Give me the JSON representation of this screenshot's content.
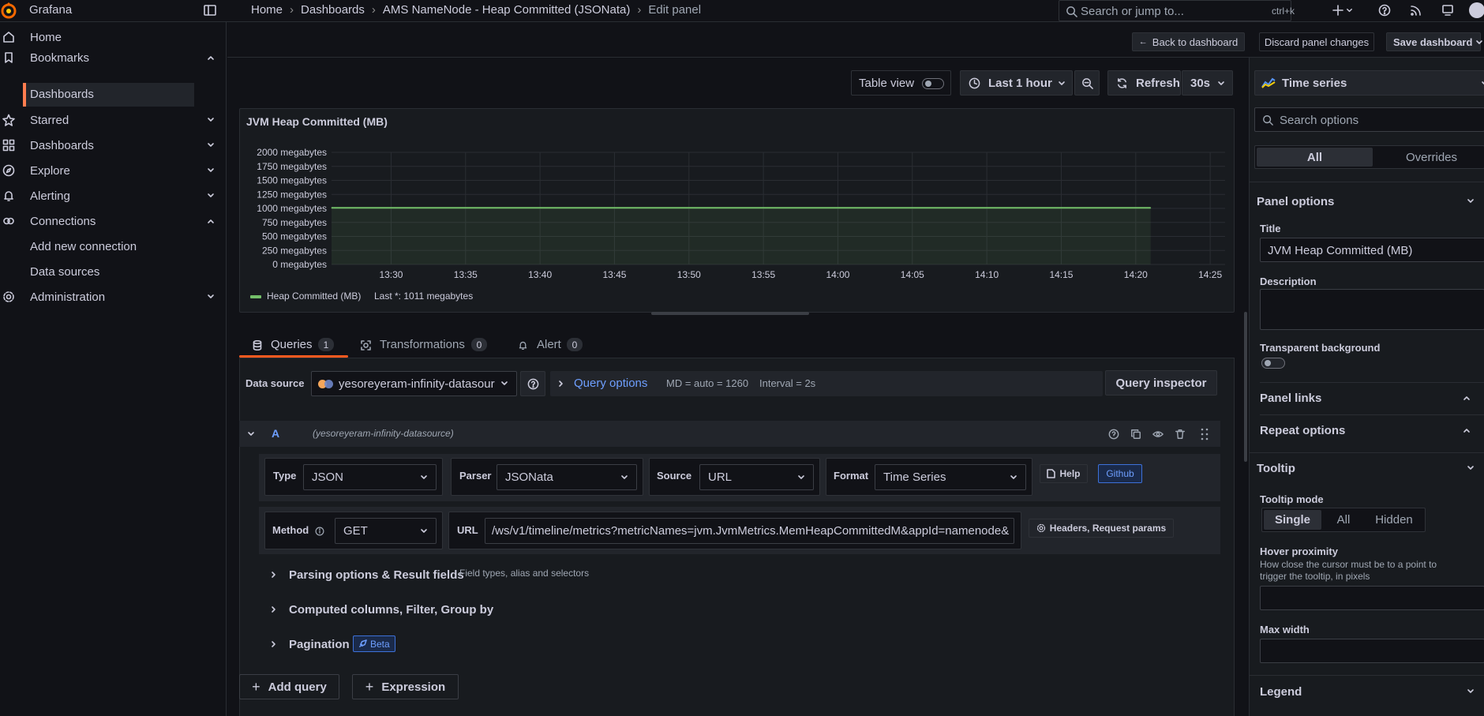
{
  "app": {
    "name": "Grafana"
  },
  "breadcrumb": [
    "Home",
    "Dashboards",
    "AMS NameNode - Heap Committed (JSONata)",
    "Edit panel"
  ],
  "search": {
    "placeholder": "Search or jump to...",
    "shortcut": "ctrl+k"
  },
  "nav": {
    "home": "Home",
    "bookmarks": "Bookmarks",
    "bookmarks_dashboards": "Dashboards",
    "starred": "Starred",
    "dashboards": "Dashboards",
    "explore": "Explore",
    "alerting": "Alerting",
    "connections": "Connections",
    "add_connection": "Add new connection",
    "data_sources": "Data sources",
    "administration": "Administration"
  },
  "toolbar": {
    "back": "Back to dashboard",
    "discard": "Discard panel changes",
    "save": "Save dashboard"
  },
  "panel_toolbar": {
    "table_view": "Table view",
    "time_range": "Last 1 hour",
    "refresh": "Refresh",
    "interval": "30s"
  },
  "chart_data": {
    "type": "line",
    "title": "JVM Heap Committed (MB)",
    "x_ticks": [
      "13:30",
      "13:35",
      "13:40",
      "13:45",
      "13:50",
      "13:55",
      "14:00",
      "14:05",
      "14:10",
      "14:15",
      "14:20",
      "14:25"
    ],
    "y_ticks": [
      "2000 megabytes",
      "1750 megabytes",
      "1500 megabytes",
      "1250 megabytes",
      "1000 megabytes",
      "750 megabytes",
      "500 megabytes",
      "250 megabytes",
      "0 megabytes"
    ],
    "ylim": [
      0,
      2000
    ],
    "x_range": [
      "13:26",
      "14:26"
    ],
    "series": [
      {
        "name": "Heap Committed (MB)",
        "color": "#73bf69",
        "x": [
          "13:26",
          "14:21"
        ],
        "values": [
          1011,
          1011
        ]
      }
    ],
    "legend": {
      "name": "Heap Committed (MB)",
      "stat": "Last *: 1011 megabytes",
      "placement": "bottom-left"
    },
    "grid": true
  },
  "tabs": [
    {
      "label": "Queries",
      "count": "1"
    },
    {
      "label": "Transformations",
      "count": "0"
    },
    {
      "label": "Alert",
      "count": "0"
    }
  ],
  "datasource_row": {
    "label": "Data source",
    "value": "yesoreyeram-infinity-datasour",
    "query_options": "Query options",
    "md": "MD = auto = 1260",
    "interval": "Interval = 2s",
    "inspector": "Query inspector"
  },
  "query": {
    "ref": "A",
    "datasource": "(yesoreyeram-infinity-datasource)",
    "type_label": "Type",
    "type_value": "JSON",
    "parser_label": "Parser",
    "parser_value": "JSONata",
    "source_label": "Source",
    "source_value": "URL",
    "format_label": "Format",
    "format_value": "Time Series",
    "help": "Help",
    "github": "Github",
    "method_label": "Method",
    "method_value": "GET",
    "url_label": "URL",
    "url_value": "/ws/v1/timeline/metrics?metricNames=jvm.JvmMetrics.MemHeapCommittedM&appId=namenode&",
    "headers": "Headers, Request params",
    "parsing": "Parsing options & Result fields",
    "parsing_hint": "Field types, alias and selectors",
    "computed": "Computed columns, Filter, Group by",
    "pagination": "Pagination",
    "beta": "Beta"
  },
  "actions": {
    "add_query": "Add query",
    "expression": "Expression"
  },
  "options": {
    "viz": "Time series",
    "search_placeholder": "Search options",
    "tab_all": "All",
    "tab_overrides": "Overrides",
    "panel_options": "Panel options",
    "title_label": "Title",
    "title_value": "JVM Heap Committed (MB)",
    "description_label": "Description",
    "transparent_label": "Transparent background",
    "panel_links": "Panel links",
    "repeat_options": "Repeat options",
    "tooltip": "Tooltip",
    "tooltip_mode": "Tooltip mode",
    "mode_single": "Single",
    "mode_all": "All",
    "mode_hidden": "Hidden",
    "hover_label": "Hover proximity",
    "hover_desc1": "How close the cursor must be to a point to",
    "hover_desc2": "trigger the tooltip, in pixels",
    "max_width": "Max width",
    "legend": "Legend"
  }
}
